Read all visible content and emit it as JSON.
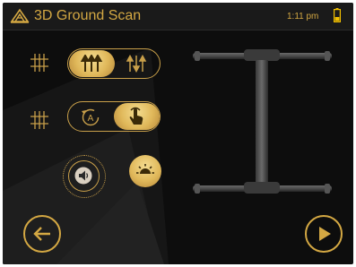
{
  "header": {
    "title": "3D Ground Scan",
    "time": "1:11 pm",
    "battery_icon": "battery-icon"
  },
  "controls": {
    "scan_mode": {
      "icon": "grid-icon",
      "options": [
        "parallel-scan-icon",
        "zigzag-scan-icon"
      ],
      "selected": 0
    },
    "scan_start": {
      "icon": "grid-icon",
      "options": [
        "automatic-mode-icon",
        "manual-tap-icon"
      ],
      "selected": 1
    },
    "sound_button": {
      "icon": "speaker-icon"
    },
    "brightness_button": {
      "icon": "brightness-icon"
    }
  },
  "navigation": {
    "back": "arrow-left-icon",
    "next": "play-icon"
  },
  "colors": {
    "accent": "#d4a843",
    "background": "#0d0d0d",
    "header": "#1a1a1a",
    "battery_level": "#f2c000"
  }
}
